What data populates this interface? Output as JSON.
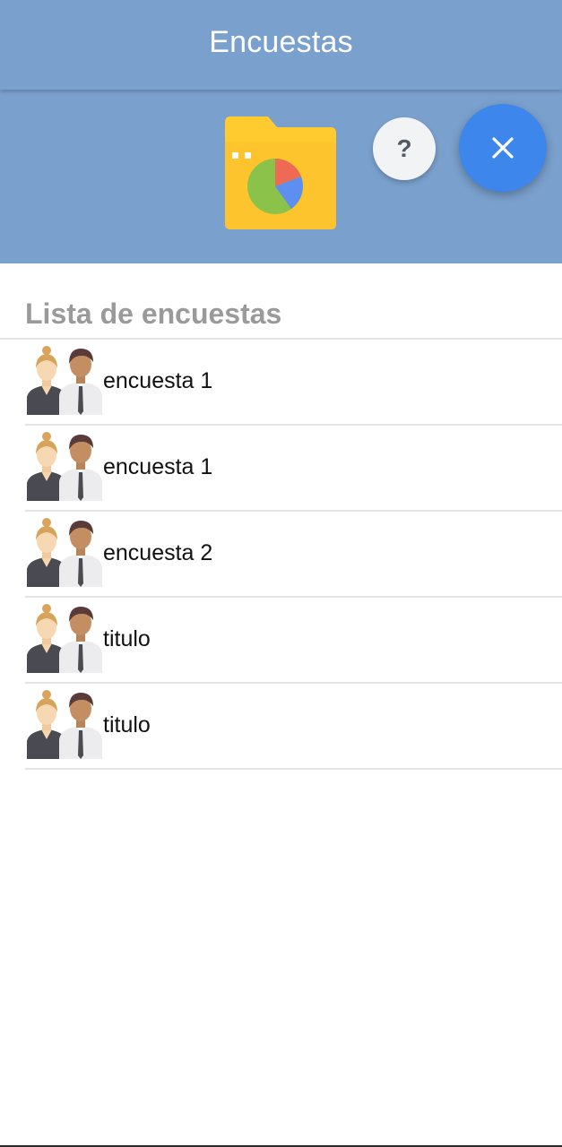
{
  "app_bar": {
    "title": "Encuestas",
    "color": "#7aa0cd"
  },
  "header": {
    "icon": "folder-pie-chart-icon",
    "help_button_label": "?",
    "close_button_icon": "close-icon",
    "close_button_color": "#3d86ec"
  },
  "survey_list": {
    "title": "Lista de encuestas",
    "items": [
      {
        "label": "encuesta 1",
        "icon": "people-avatar-icon"
      },
      {
        "label": "encuesta 1",
        "icon": "people-avatar-icon"
      },
      {
        "label": "encuesta 2",
        "icon": "people-avatar-icon"
      },
      {
        "label": "titulo",
        "icon": "people-avatar-icon"
      },
      {
        "label": "titulo",
        "icon": "people-avatar-icon"
      }
    ]
  }
}
